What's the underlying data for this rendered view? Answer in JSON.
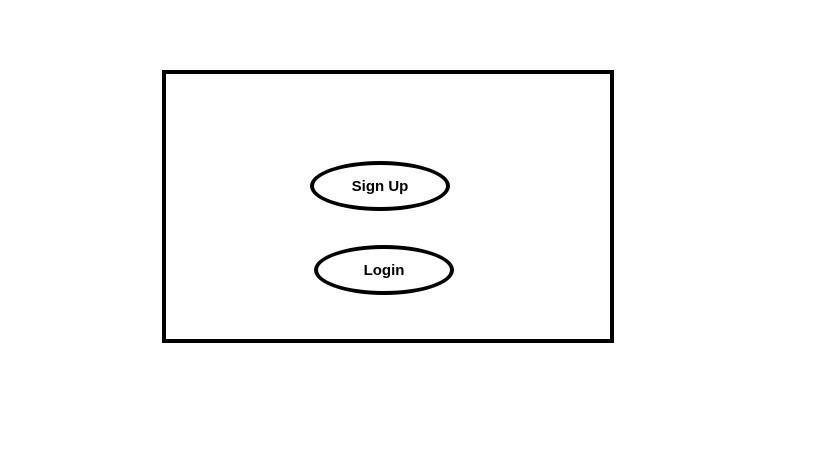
{
  "buttons": {
    "signup_label": "Sign Up",
    "login_label": "Login"
  },
  "colors": {
    "stroke": "#000000",
    "background": "#ffffff"
  }
}
